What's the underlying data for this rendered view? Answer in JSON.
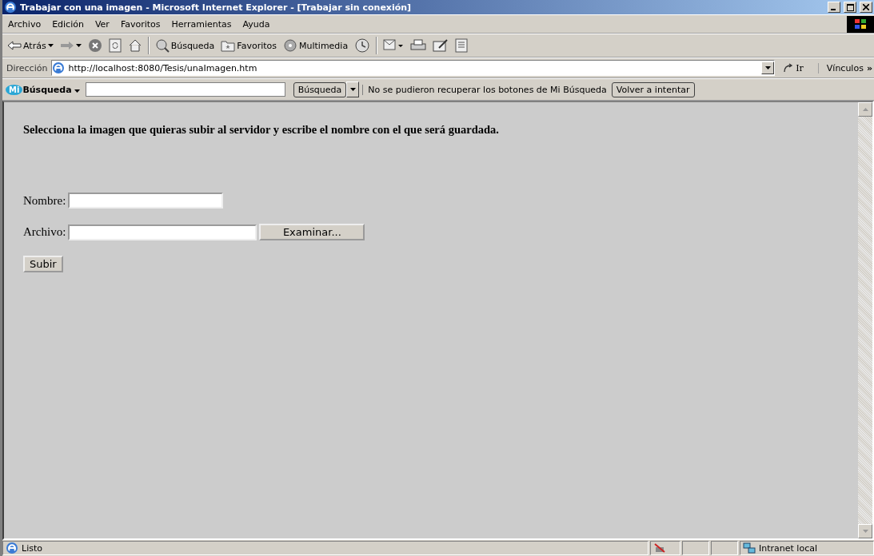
{
  "window": {
    "title": "Trabajar con una imagen - Microsoft Internet Explorer - [Trabajar sin conexión]"
  },
  "menu": [
    "Archivo",
    "Edición",
    "Ver",
    "Favoritos",
    "Herramientas",
    "Ayuda"
  ],
  "toolbar": [
    {
      "kind": "back",
      "label": "Atrás"
    },
    {
      "kind": "forward"
    },
    {
      "kind": "stop"
    },
    {
      "kind": "refresh"
    },
    {
      "kind": "home"
    },
    {
      "kind": "sep"
    },
    {
      "kind": "search",
      "label": "Búsqueda"
    },
    {
      "kind": "favorites",
      "label": "Favoritos"
    },
    {
      "kind": "media",
      "label": "Multimedia"
    },
    {
      "kind": "history"
    },
    {
      "kind": "sep"
    },
    {
      "kind": "mail"
    },
    {
      "kind": "print"
    },
    {
      "kind": "edit"
    },
    {
      "kind": "discuss"
    }
  ],
  "address_bar": {
    "label": "Dirección",
    "value": "http://localhost:8080/Tesis/unaImagen.htm",
    "go": "Ir",
    "links": "Vínculos",
    "more": "»"
  },
  "search_bar": {
    "logo": "Mi",
    "brand": "Búsqueda",
    "button": "Búsqueda",
    "message": "No se pudieron recuperar los botones de Mi Búsqueda",
    "retry": "Volver a intentar"
  },
  "page": {
    "heading": "Selecciona la imagen que quieras subir al servidor y escribe el nombre con el que será guardada.",
    "name_label": "Nombre:",
    "file_label": "Archivo:",
    "browse": "Examinar...",
    "submit": "Subir"
  },
  "status_bar": {
    "text": "Listo",
    "zone": "Intranet local"
  }
}
